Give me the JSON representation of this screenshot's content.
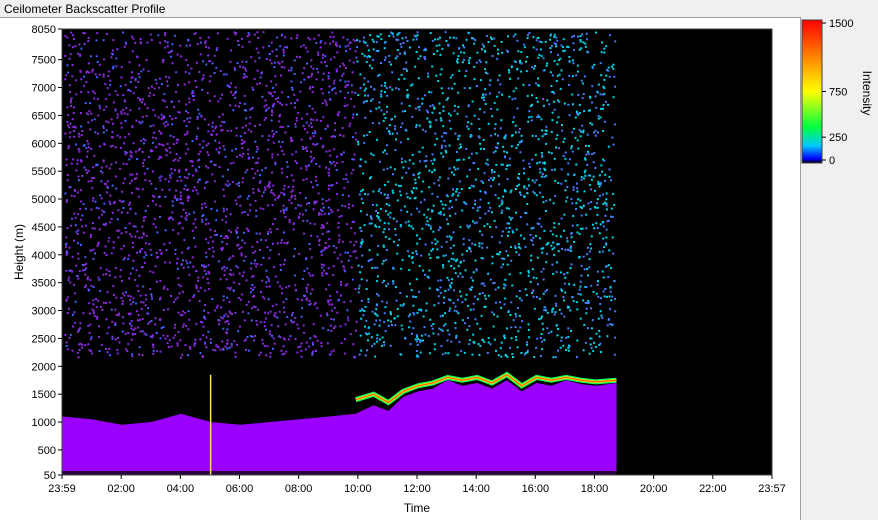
{
  "window": {
    "title": "Ceilometer Backscatter Profile"
  },
  "colors": {
    "background": "#000000",
    "low": "#9b00ff",
    "mid": "#00e5e5",
    "high": "#ffd000",
    "peak": "#ff0000"
  },
  "chart_data": {
    "type": "heatmap",
    "title": "",
    "xlabel": "Time",
    "ylabel": "Height (m)",
    "x_ticks": [
      "23:59",
      "02:00",
      "04:00",
      "06:00",
      "08:00",
      "10:00",
      "12:00",
      "14:00",
      "16:00",
      "18:00",
      "20:00",
      "22:00",
      "23:57"
    ],
    "y_ticks": [
      50,
      500,
      1000,
      1500,
      2000,
      2500,
      3000,
      3500,
      4000,
      4500,
      5000,
      5500,
      6000,
      6500,
      7000,
      7500,
      8050
    ],
    "ylim": [
      50,
      8050
    ],
    "xlim_hours": [
      -0.0167,
      23.95
    ],
    "data_end_hour": 18.7,
    "colorbar": {
      "label": "Intensity",
      "ticks": [
        0,
        250,
        750,
        1500
      ],
      "range": [
        0,
        1500
      ]
    },
    "boundary_layer_top_m": {
      "hours": [
        0,
        1,
        2,
        3,
        4,
        5,
        6,
        7,
        8,
        9,
        9.9,
        10.5,
        11,
        11.5,
        12,
        12.5,
        13,
        13.5,
        14,
        14.5,
        15,
        15.5,
        16,
        16.5,
        17,
        17.5,
        18,
        18.7
      ],
      "height": [
        1100,
        1050,
        950,
        1000,
        1150,
        1000,
        950,
        1000,
        1050,
        1100,
        1150,
        1300,
        1200,
        1450,
        1550,
        1600,
        1750,
        1650,
        1700,
        1600,
        1750,
        1550,
        1700,
        1650,
        1750,
        1680,
        1650,
        1700
      ]
    },
    "signal_layer_top_m": {
      "hours": [
        9.9,
        10.5,
        11,
        11.5,
        12,
        12.5,
        13,
        13.5,
        14,
        14.5,
        15,
        15.5,
        16,
        16.5,
        17,
        17.5,
        18,
        18.7
      ],
      "height": [
        1400,
        1500,
        1350,
        1550,
        1650,
        1700,
        1800,
        1750,
        1800,
        1700,
        1850,
        1650,
        1800,
        1750,
        1800,
        1750,
        1720,
        1750
      ]
    }
  }
}
